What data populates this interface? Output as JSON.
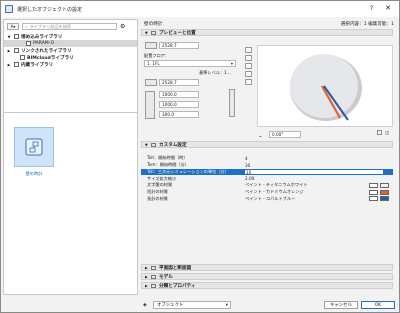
{
  "window": {
    "title": "選択したオブジェクトの設定",
    "help": "?",
    "close": "✕"
  },
  "search": {
    "placeholder": "ライブラリ部品を検索",
    "view_label": "A▾"
  },
  "tree": [
    {
      "label": "埋め込みライブラリ",
      "bold": true,
      "arrow": "▼",
      "level": 0
    },
    {
      "label": "PARAM-O",
      "bold": false,
      "arrow": "",
      "level": 2
    },
    {
      "label": "リンクされたライブラリ",
      "bold": true,
      "arrow": "▶",
      "level": 0
    },
    {
      "label": "BIMcloudライブラリ",
      "bold": true,
      "arrow": "",
      "level": 1
    },
    {
      "label": "内蔵ライブラリ",
      "bold": true,
      "arrow": "▶",
      "level": 0
    }
  ],
  "thumbnail": {
    "label": "壁の時計"
  },
  "header": {
    "name": "壁の時計",
    "status": "選択内容：1 編集可能：1"
  },
  "preview": {
    "section_label": "プレビューと位置",
    "width": "2528.7",
    "floor_label": "配置フロア:",
    "floor_value": "1. 1FL",
    "elevation_label": "基準レベル：1...",
    "height": "2528.7",
    "offset1": "1000.0",
    "offset2": "1000.0",
    "offset3": "300.0",
    "angle": "0.00°"
  },
  "custom": {
    "section_label": "カスタム設定",
    "rows": [
      {
        "key": "Toh：開始時間（時）",
        "value": "4"
      },
      {
        "key": "Tom：開始時間（分）",
        "value": "30"
      },
      {
        "key": "Tsh：三次元シミュレーションの単位（分）",
        "value": "10"
      },
      {
        "key": "サイズ拡大縮小",
        "value": "2.00"
      },
      {
        "key": "文字盤の材質",
        "value": "ペイント - ティタニウムホワイト"
      },
      {
        "key": "短針の材質",
        "value": "ペイント - カドミウムオレンジ"
      },
      {
        "key": "長針の材質",
        "value": "ペイント - コバルトブルー"
      }
    ]
  },
  "collapsed_sections": [
    {
      "label": "平面図と断面図"
    },
    {
      "label": "モデル"
    },
    {
      "label": "分類とプロパティ"
    }
  ],
  "footer": {
    "layer": "オブジェクト",
    "cancel": "キャンセル",
    "ok": "OK"
  },
  "colors": {
    "accent": "#1f6fc8",
    "orange": "#e0642a",
    "blue": "#2a5aa8",
    "white_swatch": "#f4f4f4"
  }
}
